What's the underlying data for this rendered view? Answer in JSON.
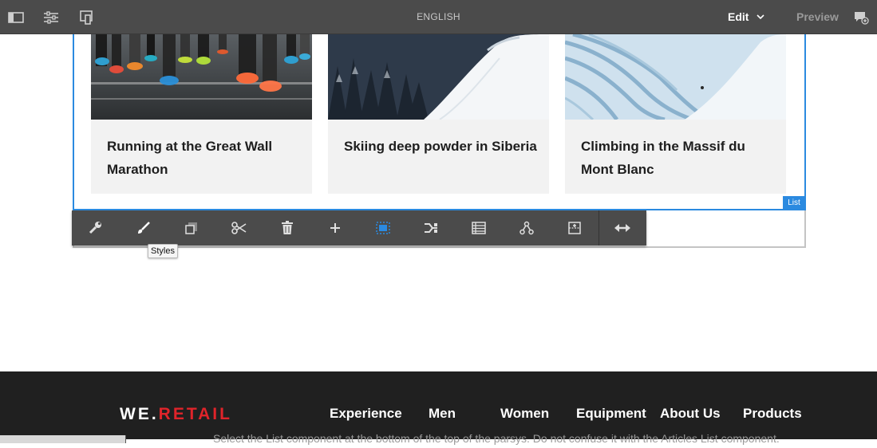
{
  "topbar": {
    "title": "ENGLISH",
    "edit_label": "Edit",
    "preview_label": "Preview",
    "icons": [
      "side-panel-icon",
      "page-properties-icon",
      "emulator-icon",
      "annotate-icon"
    ]
  },
  "cards": [
    {
      "title": "Running at the Great Wall Marathon"
    },
    {
      "title": "Skiing deep powder in Siberia"
    },
    {
      "title": "Climbing in the Massif du Mont Blanc"
    }
  ],
  "component": {
    "badge": "List"
  },
  "toolbar": {
    "tools": [
      "configure",
      "styles",
      "copy",
      "cut",
      "delete",
      "insert",
      "select-parent",
      "group",
      "layout",
      "parent",
      "convert",
      "resize"
    ],
    "tooltip": "Styles"
  },
  "footer": {
    "logo_we": "WE.",
    "logo_retail": "RETAIL",
    "nav": [
      "Experience",
      "Men",
      "Women",
      "Equipment",
      "About Us",
      "Products"
    ],
    "below_text": "Select the List component at the bottom of the top of the parsys. Do not confuse it with the Articles List component."
  },
  "colors": {
    "accent": "#2b8ae0",
    "brand_red": "#e0242a",
    "toolbar_bg": "#4b4b4b"
  }
}
